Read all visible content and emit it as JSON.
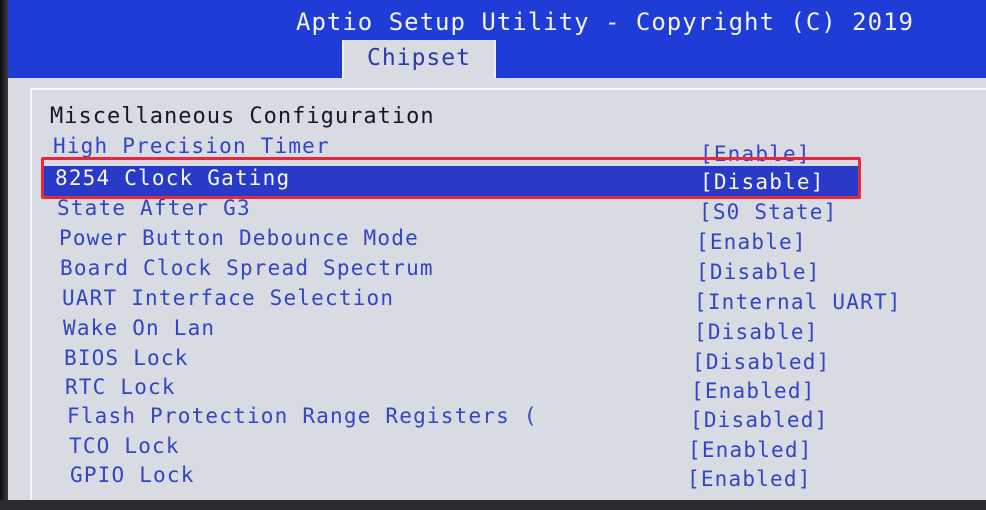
{
  "header": {
    "title": "Aptio Setup Utility - Copyright (C) 2019",
    "active_tab": "Chipset"
  },
  "section": {
    "title": "Miscellaneous Configuration"
  },
  "settings": [
    {
      "label": "High Precision Timer",
      "value": "[Enable]"
    },
    {
      "label": "8254 Clock Gating",
      "value": "[Disable]",
      "selected": true
    },
    {
      "label": "State After G3",
      "value": "[S0 State]"
    },
    {
      "label": "Power Button Debounce Mode",
      "value": "[Enable]"
    },
    {
      "label": "Board Clock Spread Spectrum",
      "value": "[Disable]"
    },
    {
      "label": "UART Interface Selection",
      "value": "[Internal UART]"
    },
    {
      "label": "Wake On Lan",
      "value": "[Disable]"
    },
    {
      "label": "BIOS Lock",
      "value": "[Disabled]"
    },
    {
      "label": "RTC Lock",
      "value": "[Enabled]"
    },
    {
      "label": "Flash Protection Range Registers (",
      "value": "[Disabled]"
    },
    {
      "label": "TCO Lock",
      "value": "[Enabled]"
    },
    {
      "label": "GPIO Lock",
      "value": "[Enabled]"
    }
  ],
  "colors": {
    "header_bg": "#1f3cd6",
    "panel_bg": "#d9dbe3",
    "item_text": "#3046c2",
    "selected_bg": "#2a3ac8",
    "annotation_box": "#e8283a"
  }
}
